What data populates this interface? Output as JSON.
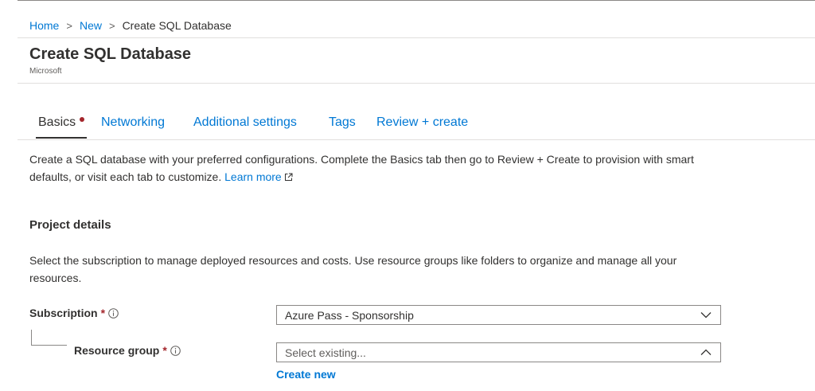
{
  "breadcrumb": {
    "home": "Home",
    "new": "New",
    "current": "Create SQL Database",
    "separator": ">"
  },
  "header": {
    "title": "Create SQL Database",
    "subtitle": "Microsoft"
  },
  "tabs": [
    {
      "label": "Basics",
      "active": true,
      "has_required_indicator": true
    },
    {
      "label": "Networking",
      "active": false
    },
    {
      "label": "Additional settings",
      "active": false
    },
    {
      "label": "Tags",
      "active": false
    },
    {
      "label": "Review + create",
      "active": false
    }
  ],
  "intro": {
    "text": "Create a SQL database with your preferred configurations. Complete the Basics tab then go to Review + Create to provision with smart defaults, or visit each tab to customize. ",
    "learn_more": "Learn more"
  },
  "project_details": {
    "title": "Project details",
    "description": "Select the subscription to manage deployed resources and costs. Use resource groups like folders to organize and manage all your resources."
  },
  "fields": {
    "subscription": {
      "label": "Subscription",
      "required_mark": "*",
      "value": "Azure Pass - Sponsorship",
      "expanded": false
    },
    "resource_group": {
      "label": "Resource group",
      "required_mark": "*",
      "placeholder": "Select existing...",
      "expanded": true,
      "create_new_label": "Create new"
    }
  },
  "colors": {
    "link": "#0078d4",
    "required": "#a4262c",
    "text": "#323130",
    "border": "#8a8886"
  }
}
